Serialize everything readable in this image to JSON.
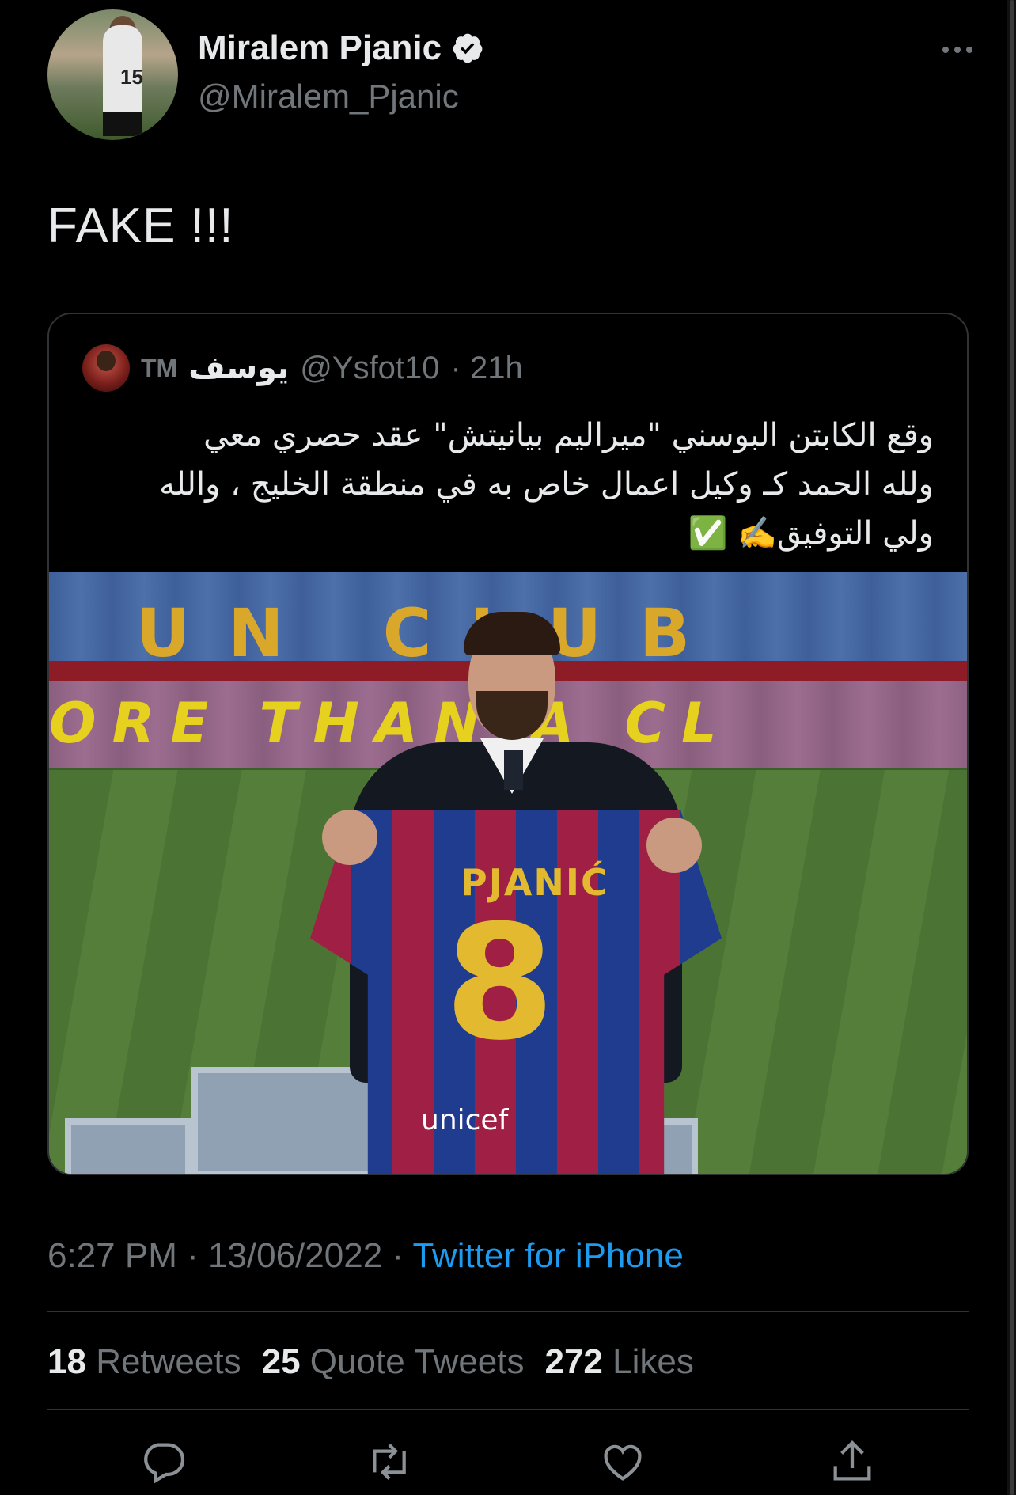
{
  "tweet": {
    "author": {
      "display_name": "Miralem Pjanic",
      "handle": "@Miralem_Pjanic",
      "avatar_jersey_number": "15"
    },
    "text": "FAKE !!!",
    "quoted": {
      "name": "يوسف",
      "name_suffix": "TM",
      "handle": "@Ysfot10",
      "time_ago": "· 21h",
      "text_lines": [
        "وقع الكابتن البوسني \"ميراليم بيانيتش\" عقد حصري معي",
        "ولله الحمد كـ وكيل اعمال خاص به في منطقة الخليج ، والله",
        "ولي التوفيق✍️ ✅"
      ],
      "media": {
        "stand_upper_letters": "UN CLUB",
        "stand_middle_letters": "ORE THAN A CL",
        "jersey_name": "PJANIĆ",
        "jersey_number": "8",
        "jersey_sponsor": "unicef"
      }
    },
    "timestamp": "6:27 PM · 13/06/2022 · ",
    "source": "Twitter for iPhone",
    "stats": {
      "retweets_count": "18",
      "retweets_label": "Retweets",
      "quotes_count": "25",
      "quotes_label": "Quote Tweets",
      "likes_count": "272",
      "likes_label": "Likes"
    }
  },
  "colors": {
    "background": "#000000",
    "text_primary": "#e7e9ea",
    "text_secondary": "#71767b",
    "link": "#1d9bf0",
    "border": "#2f3336"
  },
  "icons": [
    "verified-icon",
    "more-icon",
    "reply-icon",
    "retweet-icon",
    "like-icon",
    "share-icon"
  ]
}
